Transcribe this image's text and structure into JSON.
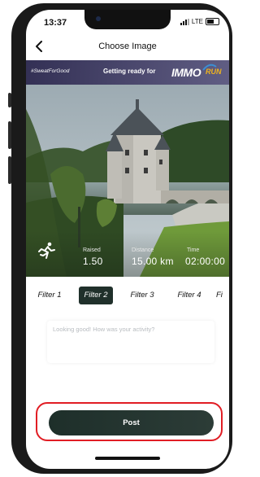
{
  "status_bar": {
    "time": "13:37",
    "network": "LTE",
    "icons": [
      "signal-icon",
      "battery-icon"
    ]
  },
  "header": {
    "title": "Choose Image",
    "back_icon": "chevron-left-icon"
  },
  "photo": {
    "banner": {
      "hashtag": "#SweatForGood",
      "text": "Getting ready for",
      "logo_text": "IMMO",
      "logo_sub": "RUN"
    },
    "stats": [
      {
        "label": "Raised",
        "value": "1.50"
      },
      {
        "label": "Distance",
        "value": "15.00 km"
      },
      {
        "label": "Time",
        "value": "02:00:00"
      }
    ],
    "activity_icon": "runner-icon"
  },
  "filters": {
    "items": [
      "Filter 1",
      "Filter 2",
      "Filter 3",
      "Filter 4",
      "Fi"
    ],
    "selected": "Filter 2"
  },
  "caption": {
    "placeholder": "Looking good! How was your activity?"
  },
  "post_button": {
    "label": "Post"
  },
  "colors": {
    "dark_green": "#20302b",
    "highlight_red": "#e11d24",
    "banner_purple": "#3a3566"
  }
}
